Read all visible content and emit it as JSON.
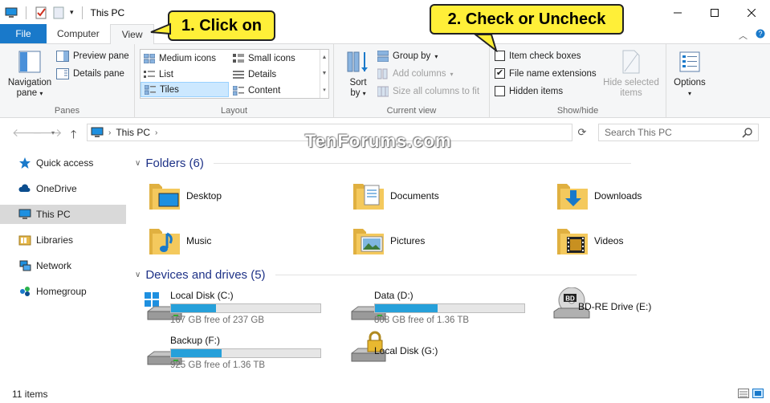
{
  "window": {
    "title": "This PC",
    "controls": [
      "minimize",
      "maximize",
      "close"
    ]
  },
  "ribbon_tabs": {
    "file": "File",
    "computer": "Computer",
    "view": "View"
  },
  "ribbon": {
    "panes": {
      "navigation_pane": "Navigation",
      "navigation_pane_2": "pane",
      "preview_pane": "Preview pane",
      "details_pane": "Details pane",
      "label": "Panes"
    },
    "layout": {
      "items": [
        "Medium icons",
        "Small icons",
        "List",
        "Details",
        "Tiles",
        "Content"
      ],
      "selected": "Tiles",
      "label": "Layout"
    },
    "current_view": {
      "sort_by": "Sort",
      "sort_by_2": "by",
      "group_by": "Group by",
      "add_columns": "Add columns",
      "size_columns": "Size all columns to fit",
      "label": "Current view"
    },
    "show_hide": {
      "item_check_boxes": "Item check boxes",
      "item_check_boxes_checked": false,
      "file_name_extensions": "File name extensions",
      "file_name_extensions_checked": true,
      "hidden_items": "Hidden items",
      "hidden_items_checked": false,
      "hide_selected": "Hide selected",
      "hide_selected_2": "items",
      "label": "Show/hide"
    },
    "options": "Options"
  },
  "callouts": {
    "step1": "1. Click on",
    "step2": "2. Check or Uncheck"
  },
  "address": {
    "path": "This PC",
    "search_placeholder": "Search This PC"
  },
  "watermark": "TenForums.com",
  "nav_pane": {
    "items": [
      "Quick access",
      "OneDrive",
      "This PC",
      "Libraries",
      "Network",
      "Homegroup"
    ],
    "selected": "This PC"
  },
  "folders": {
    "header": "Folders (6)",
    "items": [
      "Desktop",
      "Documents",
      "Downloads",
      "Music",
      "Pictures",
      "Videos"
    ]
  },
  "drives": {
    "header": "Devices and drives (5)",
    "items": [
      {
        "name": "Local Disk (C:)",
        "free": "167 GB free of 237 GB",
        "used_fraction": 0.3
      },
      {
        "name": "Data (D:)",
        "free": "808 GB free of 1.36 TB",
        "used_fraction": 0.42
      },
      {
        "name": "BD-RE Drive (E:)"
      },
      {
        "name": "Backup (F:)",
        "free": "925 GB free of 1.36 TB",
        "used_fraction": 0.34
      },
      {
        "name": "Local Disk (G:)"
      }
    ]
  },
  "status": {
    "items_count": "11 items"
  },
  "colors": {
    "accent": "#1979ca",
    "callout": "#ffef38",
    "drive_bar": "#26a0da",
    "section_header": "#1e3287",
    "folder": "#f4c95d"
  }
}
